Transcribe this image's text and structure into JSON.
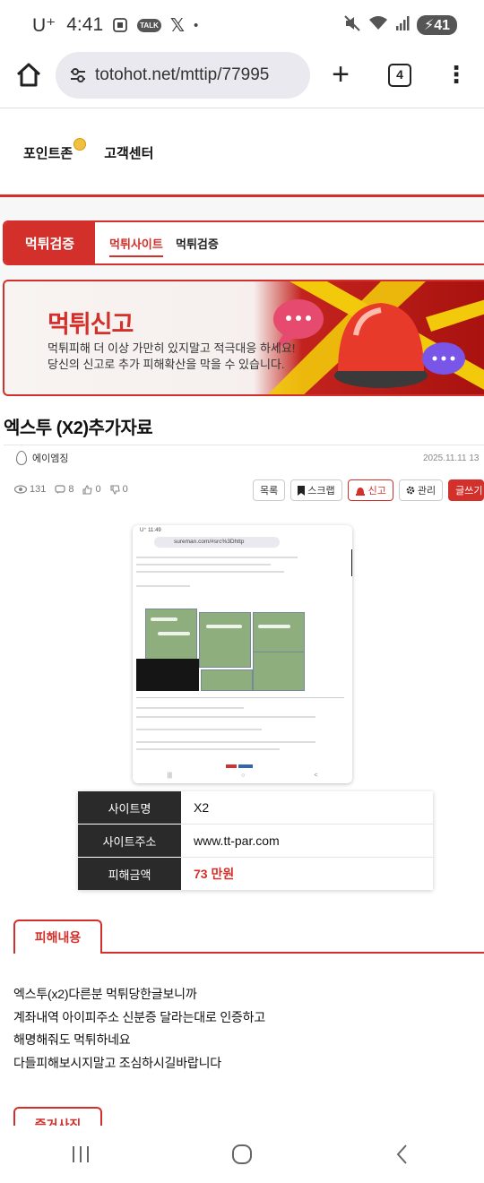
{
  "status_bar": {
    "carrier": "U⁺",
    "time": "4:41",
    "talk_badge": "TALK",
    "dot": "•",
    "battery": "41"
  },
  "browser": {
    "url": "totohot.net/mttip/77995",
    "tab_count": "4"
  },
  "top_nav": {
    "items": [
      "포인트존",
      "고객센터"
    ]
  },
  "category": {
    "main": "먹튀검증",
    "tabs": [
      "먹튀사이트",
      "먹튀검증"
    ]
  },
  "banner": {
    "title": "먹튀신고",
    "line1": "먹튀피해 더 이상 가만히 있지말고 적극대응 하세요!",
    "line2": "당신의 신고로 추가 피해확산을 막을 수 있습니다."
  },
  "post": {
    "title": "엑스투 (X2)추가자료",
    "author": "에이엠징",
    "date": "2025.11.11 13",
    "views": "131",
    "comments": "8",
    "likes": "0",
    "dislikes": "0",
    "actions": {
      "list": "목록",
      "scrap": "스크랩",
      "report": "신고",
      "manage": "관리",
      "write": "글쓰기"
    }
  },
  "embedded_screenshot": {
    "status": "U⁺ 11:49",
    "url": "sureman.com/#src%3Dhttp",
    "tab_count": "2",
    "nav": [
      "|||",
      "○",
      "<"
    ]
  },
  "info_table": {
    "rows": [
      {
        "label": "사이트명",
        "value": "X2"
      },
      {
        "label": "사이트주소",
        "value": "www.tt-par.com"
      },
      {
        "label": "피해금액",
        "value": "73 만원"
      }
    ]
  },
  "damage": {
    "tab": "피해내용",
    "lines": [
      "엑스투(x2)다른분 먹튀당한글보니까",
      "계좌내역 아이피주소 신분증 달라는대로 인증하고",
      "해명해줘도 먹튀하네요",
      "다들피해보시지말고 조심하시길바랍니다"
    ]
  },
  "evidence": {
    "tab": "증거사진"
  },
  "colors": {
    "accent": "#d3302b",
    "dark_label": "#2a2a2a"
  },
  "icons": [
    "home-icon",
    "tune-icon",
    "plus-icon",
    "tabs-icon",
    "more-icon",
    "eye-icon",
    "comment-icon",
    "thumb-up-icon",
    "thumb-down-icon",
    "bookmark-icon",
    "siren-icon",
    "gear-icon",
    "recent-apps-icon",
    "home-circle-icon",
    "back-icon"
  ]
}
